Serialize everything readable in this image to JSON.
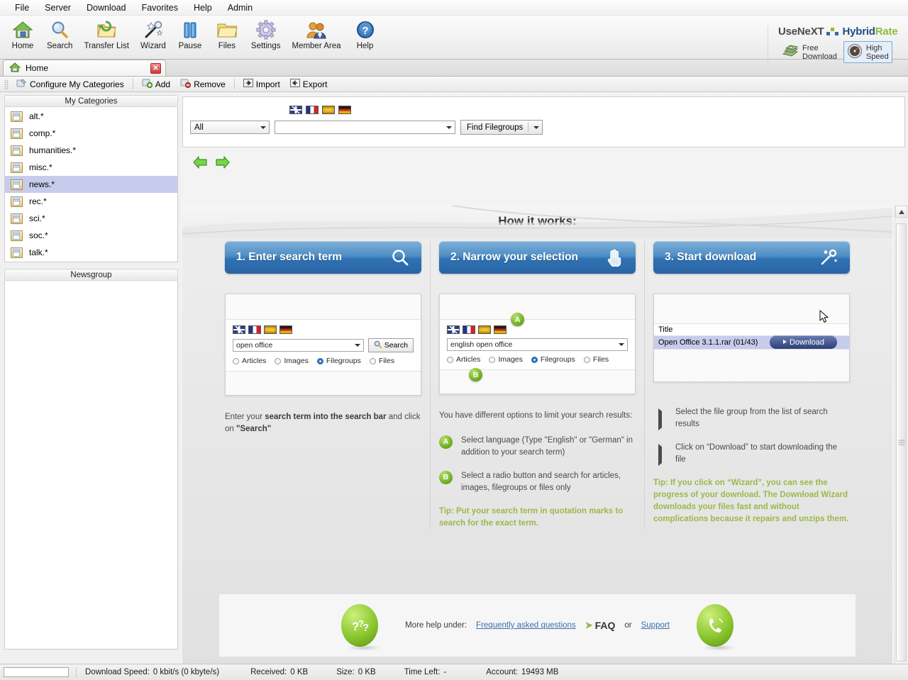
{
  "menubar": [
    "File",
    "Server",
    "Download",
    "Favorites",
    "Help",
    "Admin"
  ],
  "toolbar": [
    {
      "label": "Home",
      "icon": "home-icon"
    },
    {
      "label": "Search",
      "icon": "magnifier-icon"
    },
    {
      "label": "Transfer List",
      "icon": "folder-refresh-icon"
    },
    {
      "label": "Wizard",
      "icon": "magic-wand-icon"
    },
    {
      "label": "Pause",
      "icon": "pause-icon"
    },
    {
      "label": "Files",
      "icon": "folder-icon"
    },
    {
      "label": "Settings",
      "icon": "gear-icon"
    },
    {
      "label": "Member Area",
      "icon": "users-icon"
    },
    {
      "label": "Help",
      "icon": "question-circle-icon"
    }
  ],
  "brand": {
    "usenext": "UseNeXT",
    "hybrid": "Hybrid",
    "rate": "Rate",
    "free_download": "Free\nDownload",
    "free_download_l1": "Free",
    "free_download_l2": "Download",
    "high_speed_l1": "High",
    "high_speed_l2": "Speed"
  },
  "tab": {
    "title": "Home",
    "close": "✕"
  },
  "cattoolbar": {
    "configure": "Configure My Categories",
    "add": "Add",
    "remove": "Remove",
    "import": "Import",
    "export": "Export"
  },
  "sidebar": {
    "categories_header": "My Categories",
    "newsgroup_header": "Newsgroup",
    "items": [
      {
        "label": "alt.*",
        "selected": false
      },
      {
        "label": "comp.*",
        "selected": false
      },
      {
        "label": "humanities.*",
        "selected": false
      },
      {
        "label": "misc.*",
        "selected": false
      },
      {
        "label": "news.*",
        "selected": true
      },
      {
        "label": "rec.*",
        "selected": false
      },
      {
        "label": "sci.*",
        "selected": false
      },
      {
        "label": "soc.*",
        "selected": false
      },
      {
        "label": "talk.*",
        "selected": false
      }
    ]
  },
  "searchpanel": {
    "scope_value": "All",
    "query_value": "",
    "find_button": "Find Filegroups",
    "flags": [
      "flag-gb",
      "flag-fr",
      "flag-es",
      "flag-de"
    ]
  },
  "howitworks": {
    "title": "How it works:",
    "columns": [
      {
        "step_label": "1. Enter search term",
        "step_icon": "magnifier-icon",
        "mock": {
          "combo_value": "open office",
          "search_button": "Search",
          "radios": [
            {
              "label": "Articles",
              "selected": false
            },
            {
              "label": "Images",
              "selected": false
            },
            {
              "label": "Filegroups",
              "selected": true
            },
            {
              "label": "Files",
              "selected": false
            }
          ]
        },
        "desc_pre": "Enter your ",
        "desc_b1": "search term into the search bar",
        "desc_mid": " and click on ",
        "desc_b2": "\"Search\"",
        "desc_post": ""
      },
      {
        "step_label": "2. Narrow your selection",
        "step_icon": "hand-cursor-icon",
        "mock": {
          "combo_value": "english open office",
          "badge_a": "A",
          "badge_b": "B",
          "radios": [
            {
              "label": "Articles",
              "selected": false
            },
            {
              "label": "Images",
              "selected": false
            },
            {
              "label": "Filegroups",
              "selected": true
            },
            {
              "label": "Files",
              "selected": false
            }
          ]
        },
        "desc": "You have different options to limit your search results:",
        "bullets": [
          {
            "badge": "A",
            "text": "Select language (Type \"English\" or \"German\" in addition to your search term)"
          },
          {
            "badge": "B",
            "text": "Select a radio button and search for articles, images, filegroups or files only"
          }
        ],
        "tip": "Tip: Put your search term in quotation marks to search for the exact term."
      },
      {
        "step_label": "3. Start download",
        "step_icon": "magic-wand-icon",
        "mock": {
          "col_header": "Title",
          "row_title": "Open Office 3.1.1.rar (01/43)",
          "download_button": "Download"
        },
        "bullets": [
          {
            "text": "Select the file group from the list of search results"
          },
          {
            "text": "Click on “Download” to start downloading the file"
          }
        ],
        "tip": "Tip: If you click on “Wizard”, you can see the progress of your download. The Download Wizard downloads your files fast and without complications because it repairs and unzips them."
      }
    ]
  },
  "helpbar": {
    "orb_left": "??",
    "more_help": "More help under:",
    "faq_link": "Frequently asked questions",
    "faq_badge": "FAQ",
    "or": "or",
    "support_link": "Support",
    "orb_right": "phone-icon"
  },
  "statusbar": {
    "download_speed_label": "Download Speed:",
    "download_speed_value": "0 kbit/s (0 kbyte/s)",
    "received_label": "Received:",
    "received_value": "0 KB",
    "size_label": "Size:",
    "size_value": "0 KB",
    "timeleft_label": "Time Left:",
    "timeleft_value": "-",
    "account_label": "Account:",
    "account_value": "19493 MB"
  },
  "colors": {
    "accent_blue": "#2a6cb0",
    "accent_green": "#8fba3e",
    "selection": "#c7cbec",
    "tip_green": "#9cb84a"
  }
}
